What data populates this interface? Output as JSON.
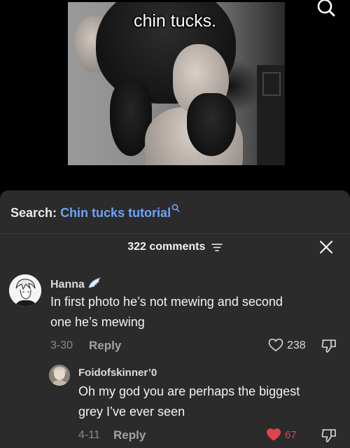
{
  "video": {
    "title": "chin tucks."
  },
  "search": {
    "prefix": "Search:",
    "query": "Chin tucks tutorial"
  },
  "comments_header": {
    "count_label": "322 comments"
  },
  "comments": [
    {
      "username": "Hanna",
      "text_line1": "In first photo he’s not mewing and second",
      "text_line2": "one he’s mewing",
      "date": "3-30",
      "reply_label": "Reply",
      "likes": "238"
    },
    {
      "username": "Foidofskinner’0",
      "text_line1": "Oh my god you are perhaps the biggest",
      "text_line2": "grey I’ve ever seen",
      "date": "4-11",
      "reply_label": "Reply",
      "likes": "67"
    }
  ],
  "colors": {
    "link_blue": "#6ea3f7",
    "like_red": "#e0434b",
    "panel_bg": "#2b2b2b"
  }
}
